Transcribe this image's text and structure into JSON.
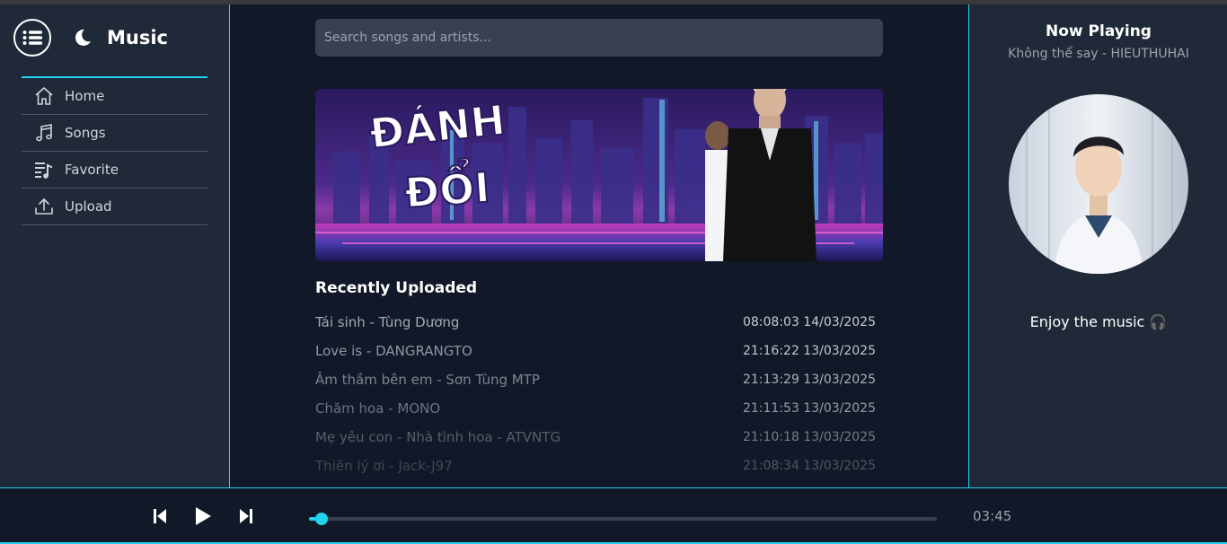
{
  "app": {
    "title": "Music"
  },
  "colors": {
    "accent": "#22d3ee",
    "panel": "#1f2937",
    "background": "#111827"
  },
  "sidebar": {
    "items": [
      {
        "label": "Home",
        "icon": "home-icon"
      },
      {
        "label": "Songs",
        "icon": "music-note-icon"
      },
      {
        "label": "Favorite",
        "icon": "playlist-icon"
      },
      {
        "label": "Upload",
        "icon": "upload-icon"
      }
    ]
  },
  "search": {
    "placeholder": "Search songs and artists...",
    "value": ""
  },
  "banner": {
    "text_line1": "ĐÁNH",
    "text_line2": "ĐỔI"
  },
  "recent": {
    "title": "Recently Uploaded",
    "songs": [
      {
        "name": "Tái sinh - Tùng Dương",
        "time": "08:08:03 14/03/2025"
      },
      {
        "name": "Love is - DANGRANGTO",
        "time": "21:16:22 13/03/2025"
      },
      {
        "name": "Âm thầm bên em - Sơn Tùng MTP",
        "time": "21:13:29 13/03/2025"
      },
      {
        "name": "Chăm hoa - MONO",
        "time": "21:11:53 13/03/2025"
      },
      {
        "name": "Mẹ yêu con - Nhà tình hoa - ATVNTG",
        "time": "21:10:18 13/03/2025"
      },
      {
        "name": "Thiên lý ơi - Jack-J97",
        "time": "21:08:34 13/03/2025"
      }
    ]
  },
  "now_playing": {
    "title": "Now Playing",
    "song": "Không thể say - HIEUTHUHAI",
    "message": "Enjoy the music 🎧"
  },
  "player": {
    "progress": 0.02,
    "duration": "03:45"
  }
}
